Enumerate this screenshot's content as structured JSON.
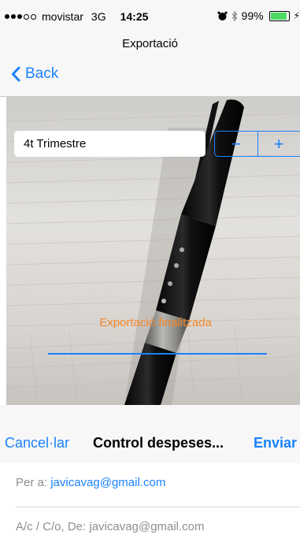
{
  "status_bar": {
    "carrier": "movistar",
    "network": "3G",
    "time": "14:25",
    "alarm_icon": "alarm-clock-icon",
    "bluetooth_icon": "bluetooth-icon",
    "battery": "99%",
    "battery_level": 0.99
  },
  "nav": {
    "title": "Exportació",
    "back_label": "Back"
  },
  "export": {
    "period_value": "4t Trimestre",
    "stepper_minus": "−",
    "stepper_plus": "+",
    "status_text": "Exportació finalitzada",
    "status_color": "#f5882a",
    "progress": 1.0
  },
  "mail": {
    "cancel_label": "Cancel·lar",
    "subject": "Control despeses...",
    "send_label": "Enviar",
    "to_label": "Per a:",
    "to_address": "javicavag@gmail.com",
    "cc_label": "A/c / C/o, De:",
    "cc_address": "javicavag@gmail.com"
  },
  "colors": {
    "accent": "#1a82fb",
    "status_orange": "#f5882a"
  }
}
